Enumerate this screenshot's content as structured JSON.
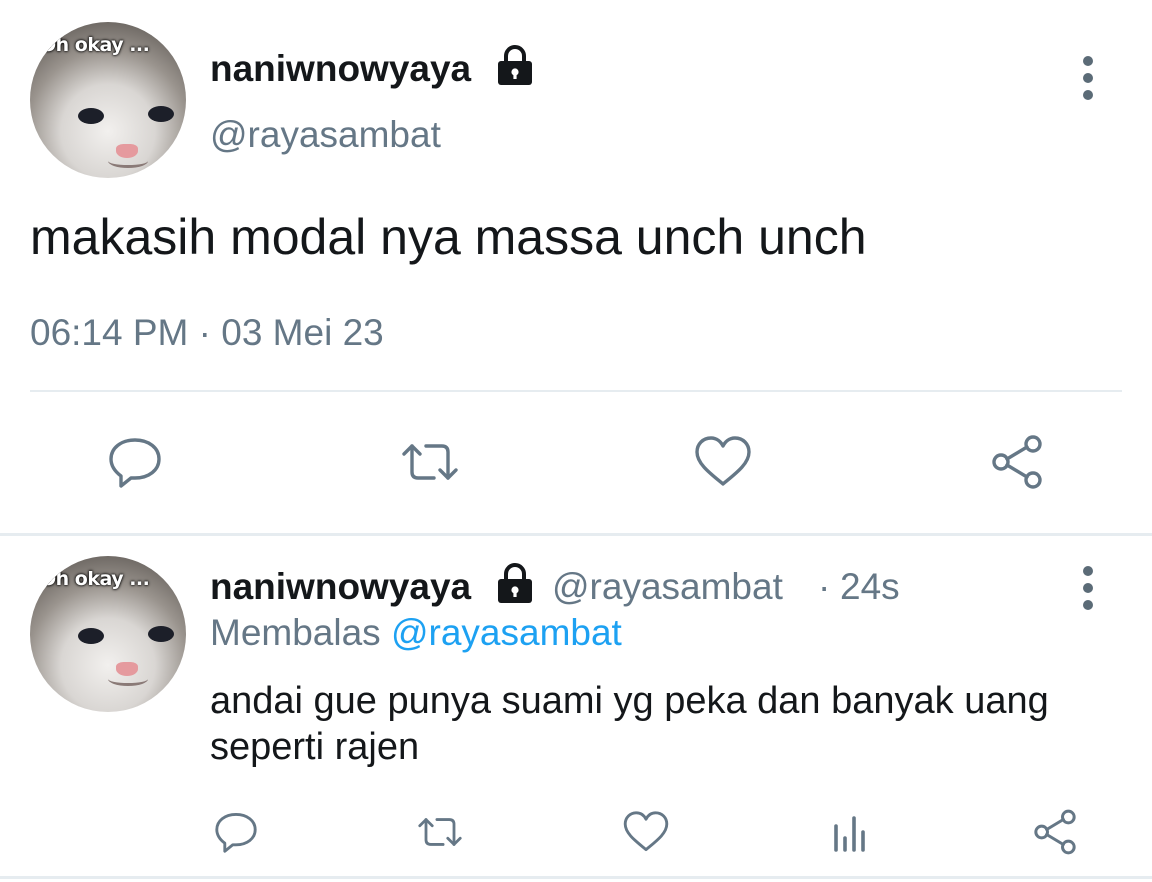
{
  "main_tweet": {
    "avatar_caption": "Oh okay ...",
    "display_name": "naniwnowyaya",
    "handle": "@rayasambat",
    "text": "makasih modal nya massa unch unch",
    "timestamp": "06:14 PM · 03 Mei 23",
    "actions": [
      "reply-icon",
      "retweet-icon",
      "like-icon",
      "share-icon"
    ]
  },
  "reply_tweet": {
    "avatar_caption": "Oh okay ...",
    "display_name": "naniwnowyaya",
    "handle": "@rayasambat",
    "separator": "·",
    "age": "24s",
    "replying_label": "Membalas",
    "replying_to": "@rayasambat",
    "text": "andai gue punya suami yg peka dan banyak uang seperti rajen",
    "actions": [
      "reply-icon",
      "retweet-icon",
      "like-icon",
      "analytics-icon",
      "share-icon"
    ]
  },
  "colors": {
    "text_primary": "#14171a",
    "text_secondary": "#657786",
    "link": "#1da1f2",
    "divider": "#e6ecf0"
  }
}
